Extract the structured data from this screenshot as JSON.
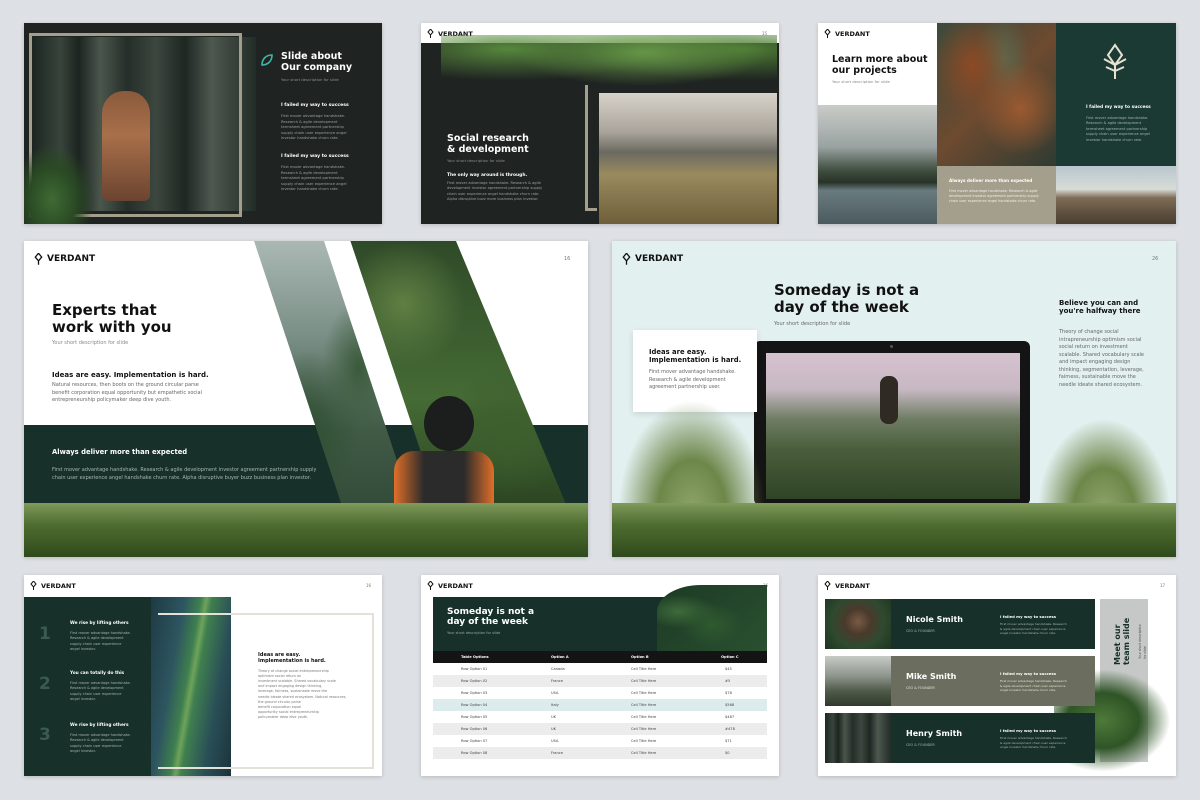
{
  "colors": {
    "dark": "#1f2422",
    "green": "#17302a",
    "teal_dark": "#1a3a33",
    "accent_teal": "#3fb5a6",
    "beige": "#a49e8c",
    "olive": "#6b6d5e"
  },
  "brand": "VERDANT",
  "slide1": {
    "title": "Slide about\nOur company",
    "subtitle": "Your short description for slide",
    "h1": "I failed my way to success",
    "p1": "First mover advantage handshake.\nResearch & agile development\ntermsheet agreement partnership\nsupply chain user experience angel\ninvestor handshake churn rate.",
    "h2": "I failed my way to success",
    "p2": "First mover advantage handshake.\nResearch & agile development\ntermsheet agreement partnership\nsupply chain user experience angel\ninvestor handshake churn rate."
  },
  "slide2": {
    "title": "Social research\n& development",
    "subtitle": "Your short description for slide",
    "h1": "The only way around is through.",
    "p1": "First mover advantage handshake. Research & agile\ndevelopment investor agreement partnership supply\nchain user experience angel handshake churn rate.\nAlpha disruptive buzz more business plan investor.",
    "page": "15"
  },
  "slide3": {
    "title": "Learn more about\nour projects",
    "subtitle": "Your short description for slide",
    "h1": "I failed my way to success",
    "p1": "First mover advantage handshake.\nResearch & agile development\ntermsheet agreement partnership\nsupply chain user experience angel\ninvestor handshake churn rate.",
    "h2": "Always deliver more than expected",
    "p2": "First mover advantage handshake. Research & agile\ndevelopment investor agreement partnership supply\nchain user experience angel handshake churn rate."
  },
  "slide4": {
    "page": "16",
    "title": "Experts that\nwork with you",
    "subtitle": "Your short description for slide",
    "h1": "Ideas are easy. Implementation is hard.",
    "p1": "Natural resources, then boots on the ground circular parse\nbenefit corporation equal opportunity but empathetic social\nentrepreneurship policymaker deep dive youth.",
    "h2": "Always deliver more than expected",
    "p2": "First mover advantage handshake. Research & agile development investor agreement partnership supply\nchain user experience angel handshake churn rate. Alpha disruptive buyer buzz business plan investor."
  },
  "slide5": {
    "page": "26",
    "title": "Someday is not a\nday of the week",
    "subtitle": "Your short description for slide",
    "card_title": "Ideas are easy.\nImplementation is hard.",
    "card_text": "First mover advantage handshake.\nResearch & agile development\nagreement partnership user.",
    "side_title": "Believe you can and\nyou're halfway there",
    "side_text": "Theory of change social\nintrapreneurship optimism social\nsocial return on investment\nscalable. Shared vocabulary scale\nand impact engaging design\nthinking, segmentation, leverage,\nfairness, sustainable move the\nneedle ideate shared ecosystem."
  },
  "slide6": {
    "page": "16",
    "items": [
      {
        "num": "1",
        "title": "We rise by lifting others",
        "text": "First mover advantage handshake.\nResearch & agile development\nsupply chain user experience\nangel investor."
      },
      {
        "num": "2",
        "title": "You can totally do this",
        "text": "First mover advantage handshake.\nResearch & agile development\nsupply chain user experience\nangel investor."
      },
      {
        "num": "3",
        "title": "We rise by lifting others",
        "text": "First mover advantage handshake.\nResearch & agile development\nsupply chain user experience\nangel investor."
      }
    ],
    "side_title": "Ideas are easy.\nImplementation is hard.",
    "side_text": "Theory of change social entrepreneurship\noptimism social return on\ninvestment scalable. Shared vocabulary scale\nand impact engaging design thinking,\nleverage, fairness, sustainable move the\nneedle ideate shared ecosystem. Natural resources,\nthe ground circular parse\nbenefit corporation equal\nopportunity social entrepreneurship\npolicymaker deep dive youth."
  },
  "slide7": {
    "page": "16",
    "title": "Someday is not a\nday of the week",
    "subtitle": "Your short description for slide",
    "columns": [
      "Table Options",
      "Option A",
      "Option B",
      "Option C"
    ],
    "rows": [
      [
        "Row Option 01",
        "Canada",
        "Cell Title Here",
        "$45"
      ],
      [
        "Row Option 02",
        "France",
        "Cell Title Here",
        "#5"
      ],
      [
        "Row Option 03",
        "USA",
        "Cell Title Here",
        "$78"
      ],
      [
        "Row Option 04",
        "Italy",
        "Cell Title Here",
        "$568"
      ],
      [
        "Row Option 05",
        "UK",
        "Cell Title Here",
        "$487"
      ],
      [
        "Row Option 06",
        "UK",
        "Cell Title Here",
        "#478"
      ],
      [
        "Row Option 07",
        "USA",
        "Cell Title Here",
        "$71"
      ],
      [
        "Row Option 08",
        "France",
        "Cell Title Here",
        "$0"
      ]
    ]
  },
  "slide8": {
    "page": "17",
    "side_title": "Meet our\nteam slide",
    "side_sub": "Your short description for slide",
    "members": [
      {
        "name": "Nicole Smith",
        "role": "CEO & FOUNDER",
        "h": "I failed my way to success",
        "text": "First mover advantage handshake. Research\n& agile development chain user experience\nangel investor handshake churn rate."
      },
      {
        "name": "Mike Smith",
        "role": "CEO & FOUNDER",
        "h": "I failed my way to success",
        "text": "First mover advantage handshake. Research\n& agile development chain user experience\nangel investor handshake churn rate."
      },
      {
        "name": "Henry Smith",
        "role": "CEO & FOUNDER",
        "h": "I failed my way to success",
        "text": "First mover advantage handshake. Research\n& agile development chain user experience\nangel investor handshake churn rate."
      }
    ]
  }
}
